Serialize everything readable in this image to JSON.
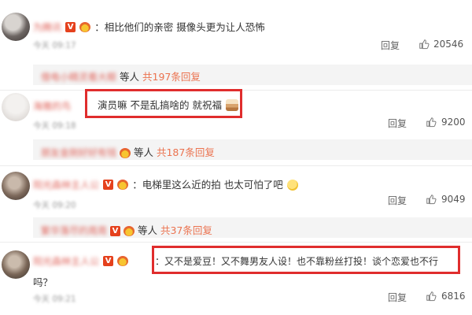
{
  "comments": [
    {
      "name": "为腾讯",
      "text": "：相比他们的亲密  摄像头更为让人恐怖",
      "time": "今天 09:17",
      "reply_label": "回复",
      "likes": "20546",
      "replies": {
        "names": "借电小精灵看大眼",
        "suffix": "等人",
        "count": "共197条回复"
      }
    },
    {
      "name": "海雅的鸟",
      "text": "演员嘛 不是乱搞啥的 就祝福",
      "time": "今天 09:18",
      "reply_label": "回复",
      "likes": "9200",
      "replies": {
        "names": "朋友金刚好好有钱",
        "suffix": "等人",
        "count": "共187条回复"
      }
    },
    {
      "name": "阳光森林主人公",
      "text": "：电梯里这么近的拍 也太可怕了吧",
      "time": "今天 09:20",
      "reply_label": "回复",
      "likes": "9049",
      "replies": {
        "names": "繁华落尽的周周",
        "suffix": "等人",
        "count": "共37条回复"
      }
    },
    {
      "name": "阳光森林主人公",
      "text": "：又不是爱豆！又不舞男友人设！也不靠粉丝打投！谈个恋爱也不行",
      "text2": "吗？",
      "time": "今天 09:21",
      "reply_label": "回复",
      "likes": "6816"
    }
  ],
  "colors": {
    "accent": "#eb7350",
    "highlight_box": "#e02d2d",
    "v_badge": "#e5411d"
  },
  "icons": {
    "like": "thumbs-up-icon",
    "verified": "v-badge-icon",
    "member": "crown-icon"
  }
}
